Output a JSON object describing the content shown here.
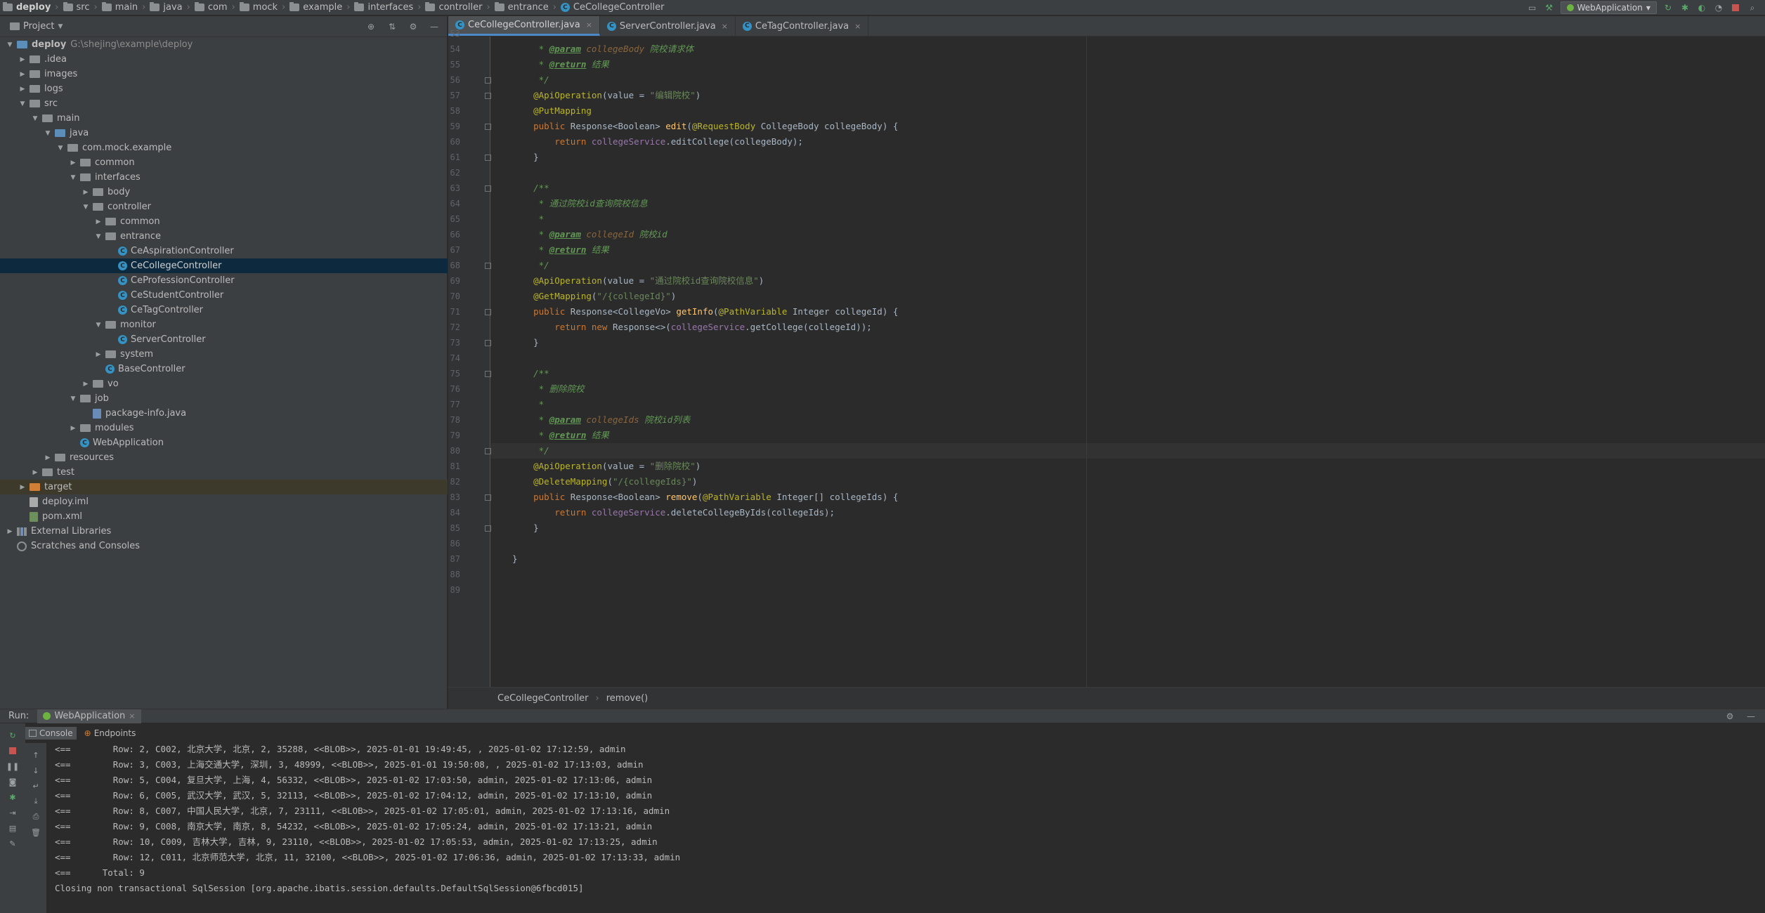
{
  "navbar": {
    "project": "deploy",
    "crumbs": [
      "src",
      "main",
      "java",
      "com",
      "mock",
      "example",
      "interfaces",
      "controller",
      "entrance"
    ],
    "file": "CeCollegeController",
    "run_config": "WebApplication"
  },
  "project_panel": {
    "title": "Project",
    "tree": [
      {
        "label": "deploy",
        "extra": "G:\\shejing\\example\\deploy",
        "depth": 0,
        "open": true,
        "icon": "folder-blue",
        "bold": true
      },
      {
        "label": ".idea",
        "depth": 1,
        "open": false,
        "icon": "folder"
      },
      {
        "label": "images",
        "depth": 1,
        "open": false,
        "icon": "folder"
      },
      {
        "label": "logs",
        "depth": 1,
        "open": false,
        "icon": "folder"
      },
      {
        "label": "src",
        "depth": 1,
        "open": true,
        "icon": "folder"
      },
      {
        "label": "main",
        "depth": 2,
        "open": true,
        "icon": "folder"
      },
      {
        "label": "java",
        "depth": 3,
        "open": true,
        "icon": "folder-blue"
      },
      {
        "label": "com.mock.example",
        "depth": 4,
        "open": true,
        "icon": "package"
      },
      {
        "label": "common",
        "depth": 5,
        "open": false,
        "icon": "package"
      },
      {
        "label": "interfaces",
        "depth": 5,
        "open": true,
        "icon": "package"
      },
      {
        "label": "body",
        "depth": 6,
        "open": false,
        "icon": "package"
      },
      {
        "label": "controller",
        "depth": 6,
        "open": true,
        "icon": "package"
      },
      {
        "label": "common",
        "depth": 7,
        "open": false,
        "icon": "package"
      },
      {
        "label": "entrance",
        "depth": 7,
        "open": true,
        "icon": "package"
      },
      {
        "label": "CeAspirationController",
        "depth": 8,
        "icon": "class"
      },
      {
        "label": "CeCollegeController",
        "depth": 8,
        "icon": "class",
        "selected": true
      },
      {
        "label": "CeProfessionController",
        "depth": 8,
        "icon": "class"
      },
      {
        "label": "CeStudentController",
        "depth": 8,
        "icon": "class"
      },
      {
        "label": "CeTagController",
        "depth": 8,
        "icon": "class"
      },
      {
        "label": "monitor",
        "depth": 7,
        "open": true,
        "icon": "package"
      },
      {
        "label": "ServerController",
        "depth": 8,
        "icon": "class"
      },
      {
        "label": "system",
        "depth": 7,
        "open": false,
        "icon": "package"
      },
      {
        "label": "BaseController",
        "depth": 7,
        "icon": "class"
      },
      {
        "label": "vo",
        "depth": 6,
        "open": false,
        "icon": "package"
      },
      {
        "label": "job",
        "depth": 5,
        "open": true,
        "icon": "package"
      },
      {
        "label": "package-info.java",
        "depth": 6,
        "icon": "pkgfile"
      },
      {
        "label": "modules",
        "depth": 5,
        "open": false,
        "icon": "package"
      },
      {
        "label": "WebApplication",
        "depth": 5,
        "icon": "class-app"
      },
      {
        "label": "resources",
        "depth": 3,
        "open": false,
        "icon": "folder"
      },
      {
        "label": "test",
        "depth": 2,
        "open": false,
        "icon": "folder"
      },
      {
        "label": "target",
        "depth": 1,
        "open": false,
        "icon": "folder-orange",
        "excluded": true
      },
      {
        "label": "deploy.iml",
        "depth": 1,
        "icon": "iml"
      },
      {
        "label": "pom.xml",
        "depth": 1,
        "icon": "xml"
      },
      {
        "label": "External Libraries",
        "depth": 0,
        "open": false,
        "icon": "lib"
      },
      {
        "label": "Scratches and Consoles",
        "depth": 0,
        "icon": "scratch"
      }
    ]
  },
  "tabs": [
    {
      "label": "CeCollegeController.java",
      "active": true
    },
    {
      "label": "ServerController.java",
      "active": false
    },
    {
      "label": "CeTagController.java",
      "active": false
    }
  ],
  "code": {
    "first_line": 53,
    "current_line": 80,
    "lines": [
      [
        [
          "cm",
          "     *"
        ]
      ],
      [
        [
          "cm",
          "     * "
        ],
        [
          "tag",
          "@param"
        ],
        [
          "pn",
          " collegeBody"
        ],
        [
          "cm",
          " 院校请求体"
        ]
      ],
      [
        [
          "cm",
          "     * "
        ],
        [
          "tag",
          "@return"
        ],
        [
          "cm",
          " 结果"
        ]
      ],
      [
        [
          "cm",
          "     */"
        ]
      ],
      [
        [
          "an",
          "    @ApiOperation"
        ],
        [
          "",
          "(value = "
        ],
        [
          "st",
          "\"编辑院校\""
        ],
        [
          "",
          ")"
        ]
      ],
      [
        [
          "an",
          "    @PutMapping"
        ]
      ],
      [
        [
          "kw",
          "    public "
        ],
        [
          "",
          "Response<Boolean> "
        ],
        [
          "fn",
          "edit"
        ],
        [
          "",
          "("
        ],
        [
          "an",
          "@RequestBody"
        ],
        [
          "",
          " CollegeBody collegeBody) {"
        ]
      ],
      [
        [
          "kw",
          "        return "
        ],
        [
          "fd",
          "collegeService"
        ],
        [
          "",
          ".editCollege(collegeBody);"
        ]
      ],
      [
        [
          "",
          "    }"
        ]
      ],
      [
        [
          "",
          ""
        ]
      ],
      [
        [
          "cm",
          "    /**"
        ]
      ],
      [
        [
          "cm",
          "     * 通过院校id查询院校信息"
        ]
      ],
      [
        [
          "cm",
          "     *"
        ]
      ],
      [
        [
          "cm",
          "     * "
        ],
        [
          "tag",
          "@param"
        ],
        [
          "pn",
          " collegeId"
        ],
        [
          "cm",
          " 院校id"
        ]
      ],
      [
        [
          "cm",
          "     * "
        ],
        [
          "tag",
          "@return"
        ],
        [
          "cm",
          " 结果"
        ]
      ],
      [
        [
          "cm",
          "     */"
        ]
      ],
      [
        [
          "an",
          "    @ApiOperation"
        ],
        [
          "",
          "(value = "
        ],
        [
          "st",
          "\"通过院校id查询院校信息\""
        ],
        [
          "",
          ")"
        ]
      ],
      [
        [
          "an",
          "    @GetMapping"
        ],
        [
          "",
          "("
        ],
        [
          "st",
          "\"/{collegeId}\""
        ],
        [
          "",
          ")"
        ]
      ],
      [
        [
          "kw",
          "    public "
        ],
        [
          "",
          "Response<CollegeVo> "
        ],
        [
          "fn",
          "getInfo"
        ],
        [
          "",
          "("
        ],
        [
          "an",
          "@PathVariable"
        ],
        [
          "",
          " Integer collegeId) {"
        ]
      ],
      [
        [
          "kw",
          "        return new "
        ],
        [
          "",
          "Response<>("
        ],
        [
          "fd",
          "collegeService"
        ],
        [
          "",
          ".getCollege(collegeId));"
        ]
      ],
      [
        [
          "",
          "    }"
        ]
      ],
      [
        [
          "",
          ""
        ]
      ],
      [
        [
          "cm",
          "    /**"
        ]
      ],
      [
        [
          "cm",
          "     * 删除院校"
        ]
      ],
      [
        [
          "cm",
          "     *"
        ]
      ],
      [
        [
          "cm",
          "     * "
        ],
        [
          "tag",
          "@param"
        ],
        [
          "pn",
          " collegeIds"
        ],
        [
          "cm",
          " 院校id列表"
        ]
      ],
      [
        [
          "cm",
          "     * "
        ],
        [
          "tag",
          "@return"
        ],
        [
          "cm",
          " 结果"
        ]
      ],
      [
        [
          "cm",
          "     */"
        ]
      ],
      [
        [
          "an",
          "    @ApiOperation"
        ],
        [
          "",
          "(value = "
        ],
        [
          "st",
          "\"删除院校\""
        ],
        [
          "",
          ")"
        ]
      ],
      [
        [
          "an",
          "    @DeleteMapping"
        ],
        [
          "",
          "("
        ],
        [
          "st",
          "\"/{collegeIds}\""
        ],
        [
          "",
          ")"
        ]
      ],
      [
        [
          "kw",
          "    public "
        ],
        [
          "",
          "Response<Boolean> "
        ],
        [
          "fn",
          "remove"
        ],
        [
          "",
          "("
        ],
        [
          "an",
          "@PathVariable"
        ],
        [
          "",
          " Integer[] collegeIds) {"
        ]
      ],
      [
        [
          "kw",
          "        return "
        ],
        [
          "fd",
          "collegeService"
        ],
        [
          "",
          ".deleteCollegeByIds(collegeIds);"
        ]
      ],
      [
        [
          "",
          "    }"
        ]
      ],
      [
        [
          "",
          ""
        ]
      ],
      [
        [
          "",
          "}"
        ]
      ],
      [
        [
          "",
          ""
        ]
      ],
      [
        [
          "",
          ""
        ]
      ]
    ]
  },
  "editor_breadcrumb": {
    "class": "CeCollegeController",
    "method": "remove()"
  },
  "run": {
    "label": "Run:",
    "tab": "WebApplication",
    "console_tab": "Console",
    "endpoints_tab": "Endpoints",
    "lines": [
      "<==        Row: 2, C002, 北京大学, 北京, 2, 35288, <<BLOB>>, 2025-01-01 19:49:45, , 2025-01-02 17:12:59, admin",
      "<==        Row: 3, C003, 上海交通大学, 深圳, 3, 48999, <<BLOB>>, 2025-01-01 19:50:08, , 2025-01-02 17:13:03, admin",
      "<==        Row: 5, C004, 复旦大学, 上海, 4, 56332, <<BLOB>>, 2025-01-02 17:03:50, admin, 2025-01-02 17:13:06, admin",
      "<==        Row: 6, C005, 武汉大学, 武汉, 5, 32113, <<BLOB>>, 2025-01-02 17:04:12, admin, 2025-01-02 17:13:10, admin",
      "<==        Row: 8, C007, 中国人民大学, 北京, 7, 23111, <<BLOB>>, 2025-01-02 17:05:01, admin, 2025-01-02 17:13:16, admin",
      "<==        Row: 9, C008, 南京大学, 南京, 8, 54232, <<BLOB>>, 2025-01-02 17:05:24, admin, 2025-01-02 17:13:21, admin",
      "<==        Row: 10, C009, 吉林大学, 吉林, 9, 23110, <<BLOB>>, 2025-01-02 17:05:53, admin, 2025-01-02 17:13:25, admin",
      "<==        Row: 12, C011, 北京师范大学, 北京, 11, 32100, <<BLOB>>, 2025-01-02 17:06:36, admin, 2025-01-02 17:13:33, admin",
      "<==      Total: 9",
      "Closing non transactional SqlSession [org.apache.ibatis.session.defaults.DefaultSqlSession@6fbcd015]"
    ]
  },
  "colors": {
    "accent": "#4a88c7",
    "selection": "#0d293e",
    "class_icon": "#3592c4"
  }
}
